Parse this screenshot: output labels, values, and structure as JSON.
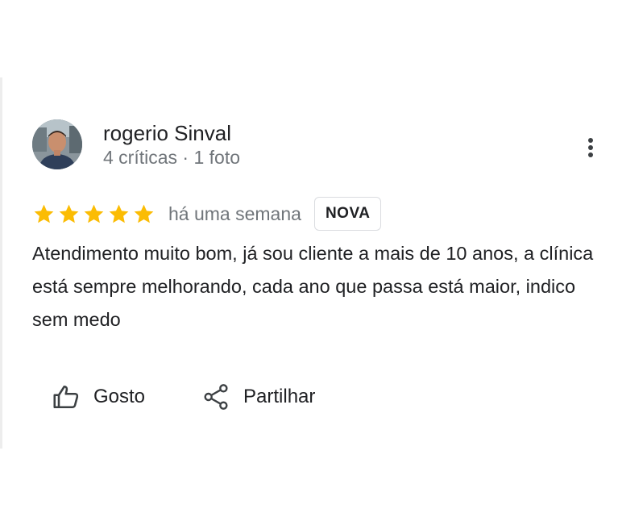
{
  "review": {
    "author_name": "rogerio Sinval",
    "author_meta": "4 críticas · 1 foto",
    "rating": 5,
    "rating_max": 5,
    "star_color": "#fbbc04",
    "time": "há uma semana",
    "badge": "NOVA",
    "text": "Atendimento muito bom, já sou cliente a mais de 10 anos, a clínica está sempre melhorando, cada ano que passa está maior, indico sem medo"
  },
  "actions": {
    "like_label": "Gosto",
    "like_icon": "thumbs-up-icon",
    "share_label": "Partilhar",
    "share_icon": "share-icon",
    "more_icon": "more-vert-icon"
  }
}
